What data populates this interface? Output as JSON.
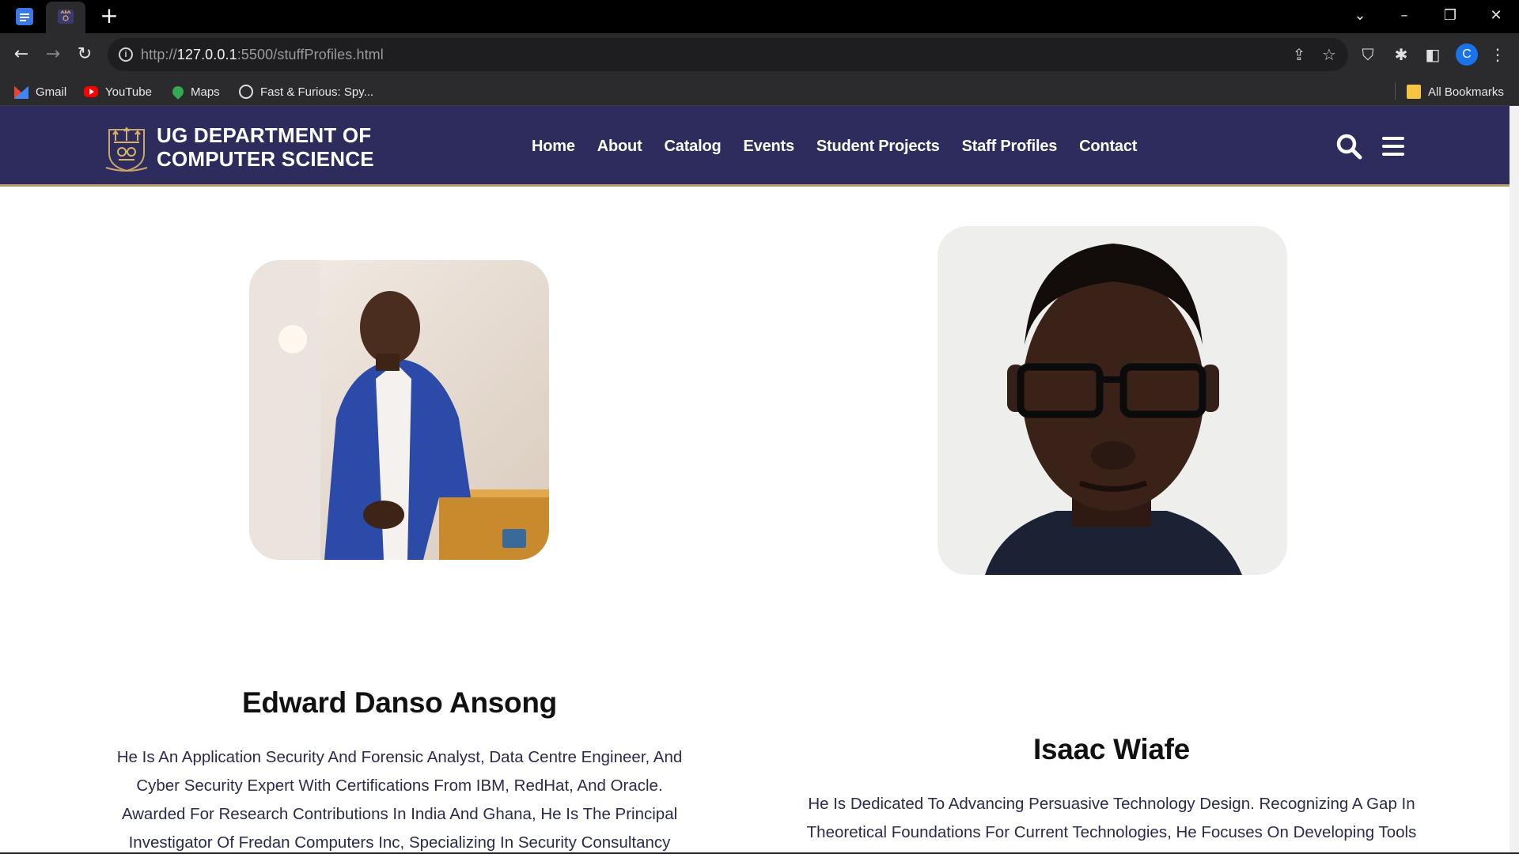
{
  "browser": {
    "address_host_prefix": "http://",
    "address_host": "127.0.0.1",
    "address_rest": ":5500/stuffProfiles.html",
    "profile_initial": "C",
    "bookmarks": [
      {
        "label": "Gmail",
        "icon": "gmail-icon"
      },
      {
        "label": "YouTube",
        "icon": "youtube-icon"
      },
      {
        "label": "Maps",
        "icon": "maps-icon"
      },
      {
        "label": "Fast & Furious: Spy...",
        "icon": "globe-icon"
      }
    ],
    "all_bookmarks_label": "All Bookmarks"
  },
  "site": {
    "brand_line1": "UG DEPARTMENT OF",
    "brand_line2": "COMPUTER SCIENCE",
    "header_color": "#2d2c5c",
    "accent_color": "#b79a6b",
    "nav": [
      "Home",
      "About",
      "Catalog",
      "Events",
      "Student Projects",
      "Staff Profiles",
      "Contact"
    ]
  },
  "staff": [
    {
      "name": "Edward Danso Ansong",
      "bio": "He Is An Application Security And Forensic Analyst, Data Centre Engineer, And Cyber Security Expert With Certifications From IBM, RedHat, And Oracle. Awarded For Research Contributions In India And Ghana, He Is The Principal Investigator Of Fredan Computers Inc, Specializing In Security Consultancy And"
    },
    {
      "name": "Isaac Wiafe",
      "bio": "He Is Dedicated To Advancing Persuasive Technology Design. Recognizing A Gap In Theoretical Foundations For Current Technologies, He Focuses On Developing Tools For"
    }
  ]
}
